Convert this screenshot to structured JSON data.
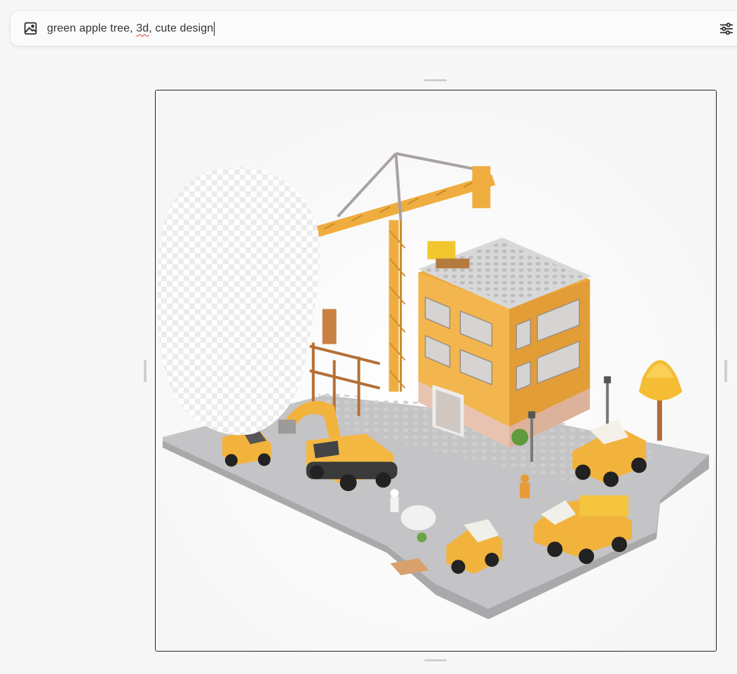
{
  "prompt": {
    "text_before": "green apple tree, ",
    "misspelled_word": "3d",
    "text_after": ", cute design",
    "leading_icon": "image-icon",
    "trailing_icon": "sliders-settings-icon"
  },
  "canvas": {
    "content": "isometric toy-brick construction site with crane, building, excavator, trucks and a tree; an erased transparent region on the left",
    "border_color": "#222222"
  },
  "colors": {
    "accent_yellow": "#f2b33d",
    "background": "#f7f7f7",
    "spellcheck_underline": "#d93a3a"
  }
}
